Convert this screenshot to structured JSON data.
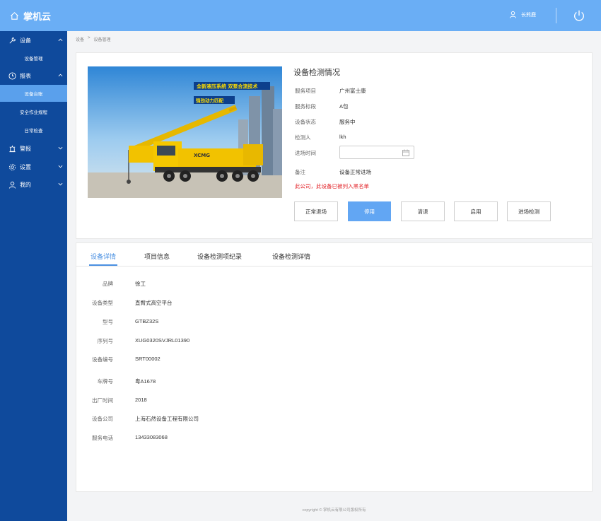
{
  "app": {
    "title": "掌机云",
    "user": "长熊鹿"
  },
  "sidebar": {
    "groups": [
      {
        "label": "设备",
        "icon": "wrench-icon"
      },
      {
        "label": "报表",
        "icon": "clock-icon"
      },
      {
        "label": "警报",
        "icon": "alarm-icon"
      },
      {
        "label": "设置",
        "icon": "gear-icon"
      },
      {
        "label": "我的",
        "icon": "user-icon"
      }
    ],
    "items": [
      {
        "label": "设备管理"
      },
      {
        "label": "设备台账"
      },
      {
        "label": "安全作业规程"
      },
      {
        "label": "日常检查"
      }
    ]
  },
  "breadcrumb": {
    "parent": "设备",
    "sep": ">",
    "current": "设备管理"
  },
  "image": {
    "banner_text": "全新液压系统 双泵合流技术",
    "banner_sub": "强劲动力匹配",
    "model_mark": "XCMG"
  },
  "inspection": {
    "title": "设备检测情况",
    "rows": [
      {
        "label": "服务项目",
        "value": "广州富士康"
      },
      {
        "label": "服务标段",
        "value": "A包"
      },
      {
        "label": "设备状态",
        "value": "服务中"
      },
      {
        "label": "检测人",
        "value": "lkh"
      },
      {
        "label": "进场时间",
        "value": ""
      },
      {
        "label": "备注",
        "value": "设备正常进场"
      }
    ],
    "warning": "此公司，此设备已被列入黑名单",
    "buttons": [
      "正常退场",
      "停用",
      "清退",
      "启用",
      "进场检测"
    ]
  },
  "tabs": [
    "设备详情",
    "项目信息",
    "设备检测项纪录",
    "设备检测详情"
  ],
  "details": [
    {
      "label": "品牌",
      "value": "徐工"
    },
    {
      "label": "设备类型",
      "value": "直臂式高空平台"
    },
    {
      "label": "型号",
      "value": "GTBZ32S"
    },
    {
      "label": "序列号",
      "value": "XUG0320SVJRL01390"
    },
    {
      "label": "设备编号",
      "value": "SRT00002"
    },
    {
      "label": "车牌号",
      "value": "粤A1678"
    },
    {
      "label": "出厂时间",
      "value": "2018"
    },
    {
      "label": "设备公司",
      "value": "上海石然设备工程有限公司"
    },
    {
      "label": "服务电话",
      "value": "13433083068"
    }
  ],
  "footer": "copyright © 掌机云有限公司版权所有",
  "colors": {
    "header": "#6aaef5",
    "sidebar": "#0f4a9c",
    "active_nav": "#5aa0ec",
    "primary_button": "#62a6f3",
    "warning": "#e3262b",
    "tab_active": "#4a90e2"
  }
}
